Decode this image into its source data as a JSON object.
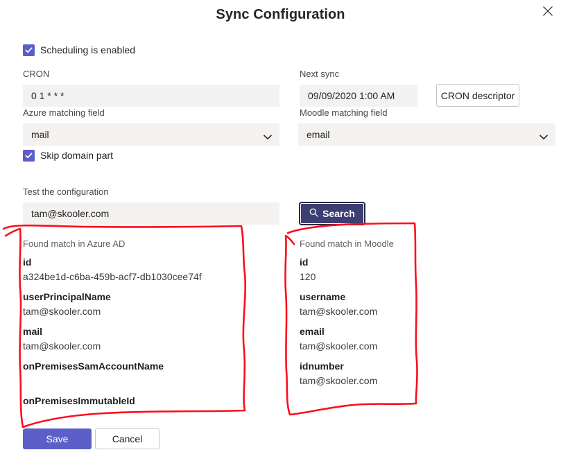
{
  "header": {
    "title": "Sync Configuration",
    "close_icon": "close-icon"
  },
  "scheduling": {
    "enabled_label": "Scheduling is enabled",
    "enabled_checked": true
  },
  "cron": {
    "label": "CRON",
    "value": "0 1 * * *",
    "placeholder": ""
  },
  "next_sync": {
    "label": "Next sync",
    "value": "09/09/2020 1:00 AM"
  },
  "cron_descriptor": {
    "label": "CRON descriptor"
  },
  "azure_matching": {
    "label": "Azure matching field",
    "value": "mail",
    "options": [
      "mail"
    ],
    "caret_icon": "chevron-down-icon"
  },
  "moodle_matching": {
    "label": "Moodle matching field",
    "value": "email",
    "options": [
      "email"
    ],
    "caret_icon": "chevron-down-icon"
  },
  "skip_domain": {
    "label": "Skip domain part",
    "checked": true
  },
  "test": {
    "label": "Test the configuration",
    "value": "tam@skooler.com",
    "placeholder": ""
  },
  "search": {
    "label": "Search",
    "icon": "search-icon"
  },
  "azure_result": {
    "caption": "Found match in Azure AD",
    "fields": [
      {
        "key": "id",
        "value": "a324be1d-c6ba-459b-acf7-db1030cee74f"
      },
      {
        "key": "userPrincipalName",
        "value": "tam@skooler.com"
      },
      {
        "key": "mail",
        "value": "tam@skooler.com"
      },
      {
        "key": "onPremisesSamAccountName",
        "value": ""
      },
      {
        "key": "onPremisesImmutableId",
        "value": ""
      }
    ]
  },
  "moodle_result": {
    "caption": "Found match in Moodle",
    "fields": [
      {
        "key": "id",
        "value": "120"
      },
      {
        "key": "username",
        "value": "tam@skooler.com"
      },
      {
        "key": "email",
        "value": "tam@skooler.com"
      },
      {
        "key": "idnumber",
        "value": "tam@skooler.com"
      }
    ]
  },
  "footer": {
    "save_label": "Save",
    "cancel_label": "Cancel"
  },
  "colors": {
    "accent": "#5b5fc7",
    "search_button": "#3d3f73",
    "input_bg": "#f3f2f1",
    "label_text": "#484644",
    "body_text": "#252423",
    "annotation": "#fc0d1c"
  }
}
